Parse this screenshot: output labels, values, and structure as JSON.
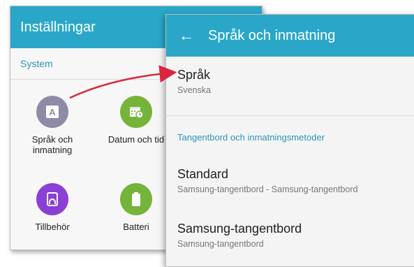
{
  "settings": {
    "title": "Inställningar",
    "section": "System",
    "tiles": [
      {
        "label": "Språk och\ninmatning",
        "color": "#8f8aa6",
        "icon": "language-icon"
      },
      {
        "label": "Datum och tid",
        "color": "#76b33a",
        "icon": "calendar-clock-icon"
      },
      {
        "label": "Tillbehör",
        "color": "#8a3fd6",
        "icon": "accessory-icon"
      },
      {
        "label": "Batteri",
        "color": "#76b33a",
        "icon": "battery-icon"
      }
    ]
  },
  "language_screen": {
    "title": "Språk och inmatning",
    "language": {
      "title": "Språk",
      "value": "Svenska"
    },
    "keyboards_section": "Tangentbord och inmatningsmetoder",
    "default_kb": {
      "title": "Standard",
      "value": "Samsung-tangentbord - Samsung-tangentbord"
    },
    "samsung_kb": {
      "title": "Samsung-tangentbord",
      "value": "Samsung-tangentbord"
    }
  },
  "colors": {
    "header": "#2aa7c8",
    "accent": "#2b95b5",
    "arrow": "#d7263d"
  }
}
